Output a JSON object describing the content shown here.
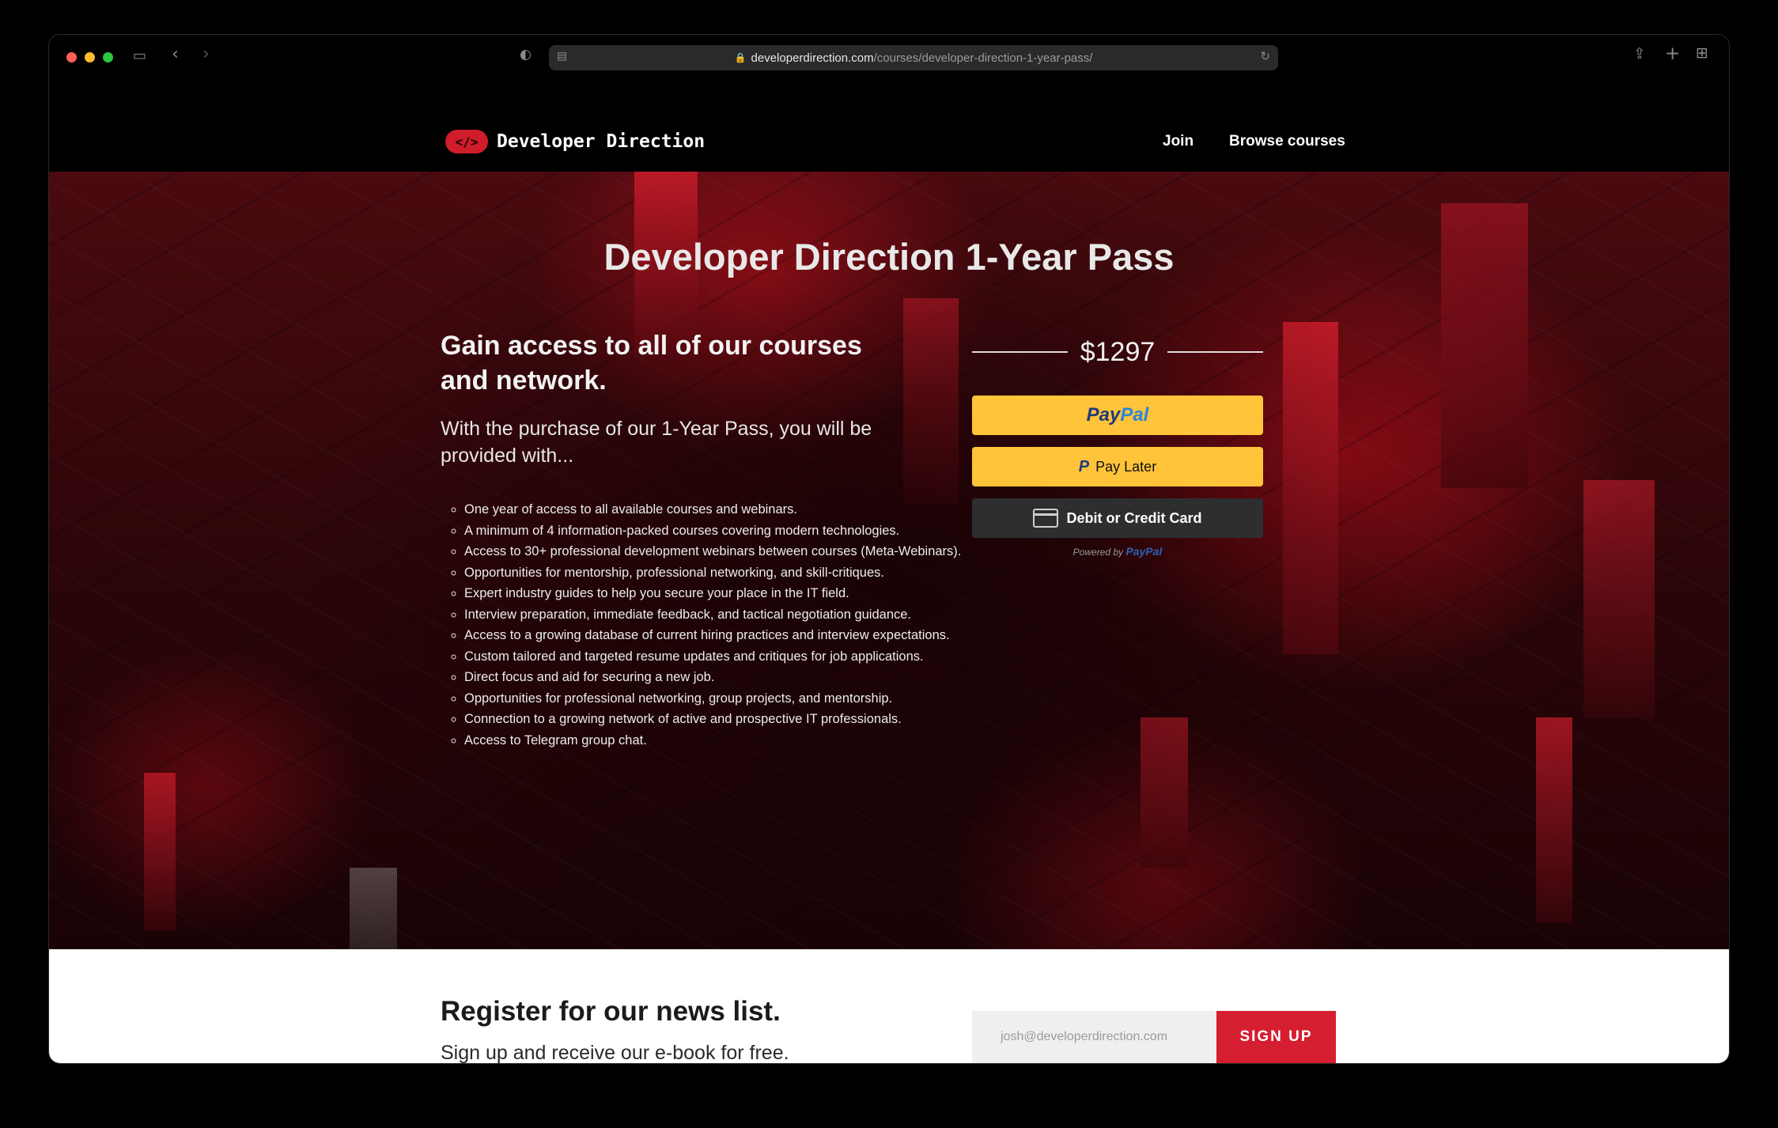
{
  "browser": {
    "url_domain": "developerdirection.com",
    "url_path": "/courses/developer-direction-1-year-pass/",
    "traffic_lights": [
      "#ff5f57",
      "#febc2e",
      "#28c840"
    ]
  },
  "header": {
    "logo_badge": "</>",
    "logo_text": "Developer Direction",
    "nav": [
      "Join",
      "Browse courses"
    ]
  },
  "hero": {
    "title": "Developer Direction 1-Year Pass",
    "heading": "Gain access to all of our courses and network.",
    "lead": "With the purchase of our 1-Year Pass, you will be provided with...",
    "benefits": [
      "One year of access to all available courses and webinars.",
      "A minimum of 4 information-packed courses covering modern technologies.",
      "Access to 30+ professional development webinars between courses (Meta-Webinars).",
      "Opportunities for mentorship, professional networking, and skill-critiques.",
      "Expert industry guides to help you secure your place in the IT field.",
      "Interview preparation, immediate feedback, and tactical negotiation guidance.",
      "Access to a growing database of current hiring practices and interview expectations.",
      "Custom tailored and targeted resume updates and critiques for job applications.",
      "Direct focus and aid for securing a new job.",
      "Opportunities for professional networking, group projects, and mentorship.",
      "Connection to a growing network of active and prospective IT professionals.",
      "Access to Telegram group chat."
    ]
  },
  "checkout": {
    "price": "$1297",
    "paypal_a": "Pay",
    "paypal_b": "Pal",
    "pay_later": "Pay Later",
    "card": "Debit or Credit Card",
    "powered_by": "Powered by",
    "powered_brand": "PayPal",
    "colors": {
      "paypal_yellow": "#ffc43a",
      "card_dark": "#2c2e2f"
    }
  },
  "newsletter": {
    "title": "Register for our news list.",
    "subtitle": "Sign up and receive our e-book for free.",
    "email_placeholder": "josh@developerdirection.com",
    "button": "SIGN UP",
    "accent": "#d51e2f"
  }
}
